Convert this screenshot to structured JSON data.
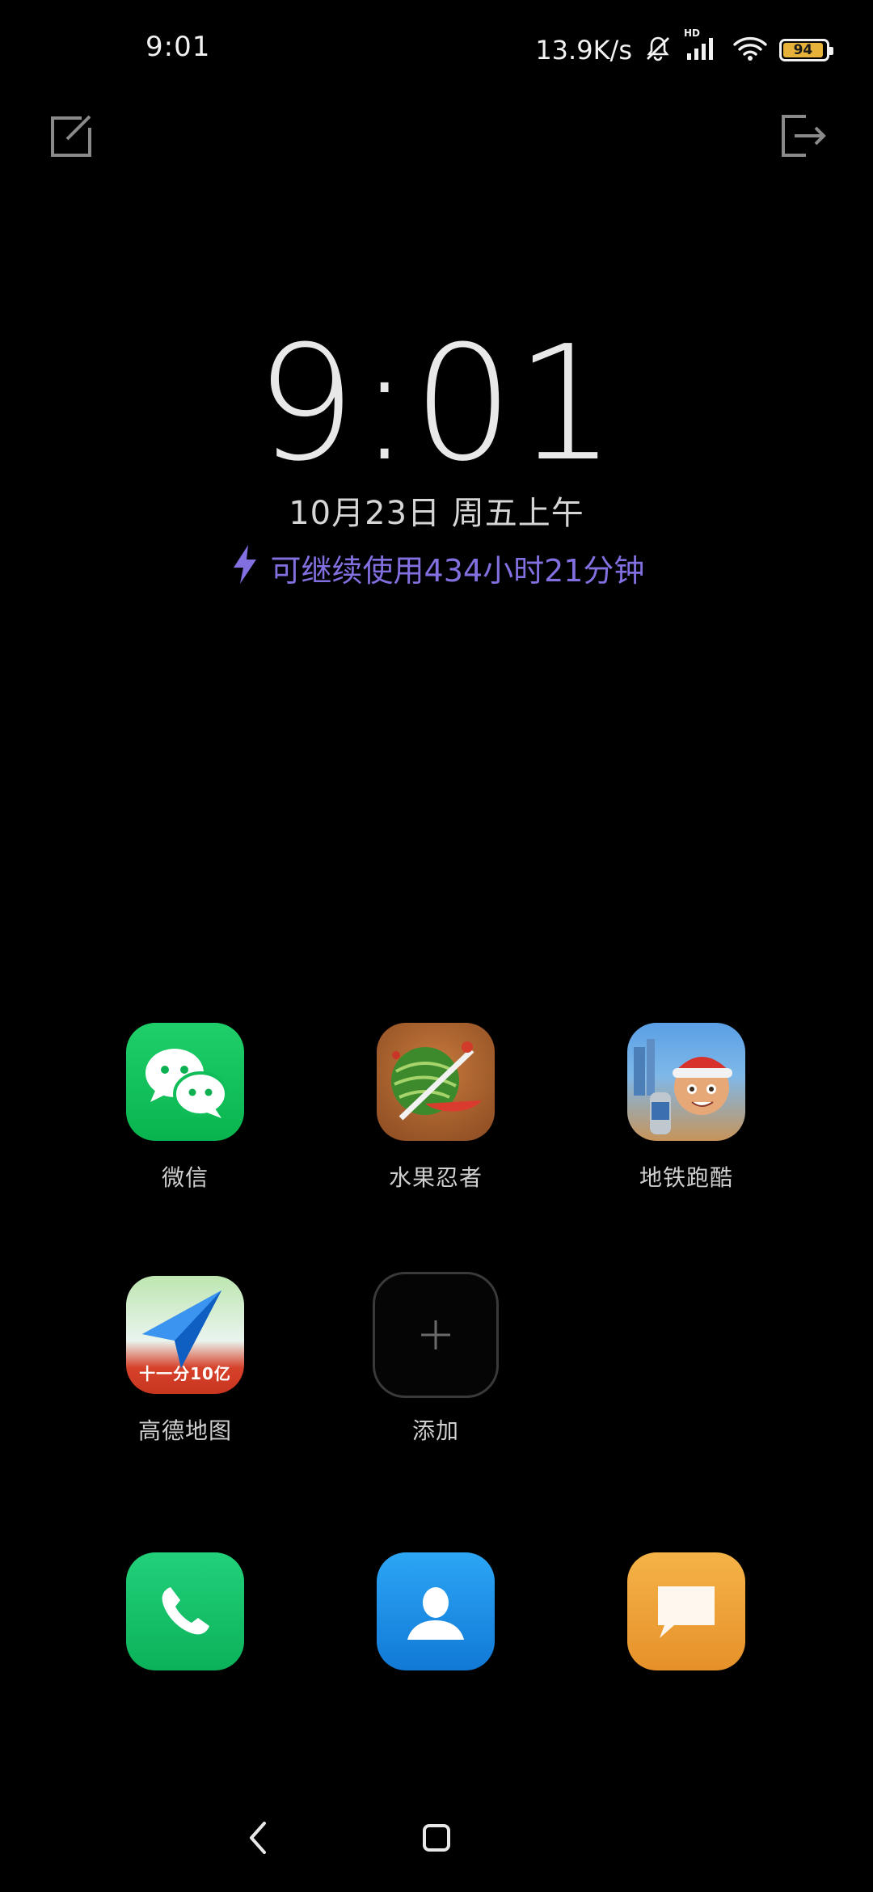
{
  "status_bar": {
    "time": "9:01",
    "net_speed": "13.9K/s",
    "network_badge": "HD",
    "battery_level": "94",
    "icons": [
      "mute-bell-icon",
      "hd-signal-icon",
      "wifi-icon",
      "battery-icon"
    ]
  },
  "top_bar": {
    "left_icon": "edit-icon",
    "right_icon": "exit-icon"
  },
  "lockscreen": {
    "clock": "9:01",
    "date": "10月23日 周五上午",
    "battery_life": "可继续使用434小时21分钟",
    "battery_life_color": "#8270e0"
  },
  "apps": [
    {
      "label": "微信",
      "icon": "wechat-icon"
    },
    {
      "label": "水果忍者",
      "icon": "fruit-ninja-icon"
    },
    {
      "label": "地铁跑酷",
      "icon": "subway-surfers-icon"
    },
    {
      "label": "高德地图",
      "icon": "amap-icon",
      "banner_text": "十一分10亿"
    },
    {
      "label": "添加",
      "icon": "plus-icon"
    }
  ],
  "dock": [
    {
      "icon": "phone-icon"
    },
    {
      "icon": "contacts-icon"
    },
    {
      "icon": "messages-icon"
    }
  ],
  "navigation": {
    "back_icon": "back-chevron-icon",
    "home_icon": "home-square-icon"
  }
}
